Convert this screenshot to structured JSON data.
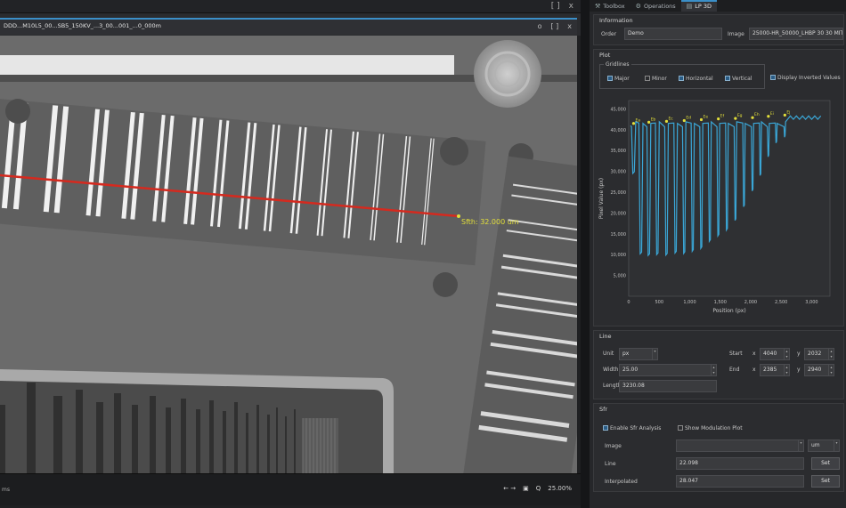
{
  "viewer": {
    "document_title": "DDD...M10L5_00...SB5_150KV_...3_00...001_...0_000m",
    "tab_buttons": [
      "o",
      "[ ]",
      "x"
    ],
    "top_buttons": [
      "[ ]",
      "x"
    ],
    "measurement_label": "Sfth: 32.000 um",
    "status_left": "ms",
    "status_right": {
      "nav": "← →",
      "zoom_icon_label": "Q",
      "zoom": "25.00%"
    }
  },
  "panel": {
    "tabs": [
      {
        "label": "Toolbox",
        "icon": "wrench-icon"
      },
      {
        "label": "Operations",
        "icon": "gear-icon"
      },
      {
        "label": "LP 3D",
        "icon": "document-icon"
      }
    ],
    "information": {
      "title": "Information",
      "order_label": "Order",
      "order_value": "Demo",
      "image_label": "Image",
      "image_value": "25000-HR_50000_LHBP 30 30 MIT"
    },
    "plot": {
      "title": "Plot",
      "gridlines_title": "Gridlines",
      "gridlines": [
        {
          "label": "Major",
          "checked": true
        },
        {
          "label": "Minor",
          "checked": false
        },
        {
          "label": "Horizontal",
          "checked": true
        },
        {
          "label": "Vertical",
          "checked": true
        }
      ],
      "display_inverted_label": "Display Inverted Values",
      "display_inverted_checked": true
    },
    "line": {
      "title": "Line",
      "unit_label": "Unit",
      "unit_value": "px",
      "width_label": "Width",
      "width_value": "25.00",
      "length_label": "Length",
      "length_value": "3230.08",
      "start_label": "Start",
      "start_x": "4040",
      "start_y": "2032",
      "end_label": "End",
      "end_x": "2385",
      "end_y": "2940",
      "x_label": "x",
      "y_label": "y"
    },
    "sfr": {
      "title": "Sfr",
      "enable_label": "Enable Sfr Analysis",
      "enable_checked": true,
      "modulation_label": "Show Modulation Plot",
      "modulation_checked": false,
      "image_label": "Image",
      "image_unit": "um",
      "line_label": "Line",
      "line_value": "22.098",
      "interpolated_label": "Interpolated",
      "interpolated_value": "28.047",
      "set_label": "Set"
    }
  },
  "colors": {
    "accent": "#3b8fc8",
    "profile_line": "#3aa6d6",
    "marker": "#e3df3a",
    "measure_line": "#d42a1f"
  },
  "chart_data": {
    "type": "line",
    "xlabel": "Position (px)",
    "ylabel": "Pixel Value (px)",
    "xlim": [
      0,
      3300
    ],
    "ylim": [
      0,
      47000
    ],
    "x_ticks": [
      0,
      500,
      1000,
      1500,
      2000,
      2500,
      3000
    ],
    "x_tick_labels": [
      "0",
      "500",
      "1,000",
      "1,500",
      "2,000",
      "2,500",
      "3,000"
    ],
    "y_ticks": [
      5000,
      10000,
      15000,
      20000,
      25000,
      30000,
      35000,
      40000,
      45000
    ],
    "y_tick_labels": [
      "5,000",
      "10,000",
      "15,000",
      "20,000",
      "25,000",
      "30,000",
      "35,000",
      "40,000",
      "45,000"
    ],
    "grid": true,
    "baseline": 41000,
    "dips": [
      {
        "x": 80,
        "min": 29500
      },
      {
        "x": 200,
        "min": 10200
      },
      {
        "x": 330,
        "min": 9800
      },
      {
        "x": 470,
        "min": 10000
      },
      {
        "x": 620,
        "min": 9900
      },
      {
        "x": 770,
        "min": 10400
      },
      {
        "x": 910,
        "min": 10300
      },
      {
        "x": 1050,
        "min": 10800
      },
      {
        "x": 1190,
        "min": 11500
      },
      {
        "x": 1330,
        "min": 13200
      },
      {
        "x": 1470,
        "min": 14500
      },
      {
        "x": 1610,
        "min": 15900
      },
      {
        "x": 1750,
        "min": 18200
      },
      {
        "x": 1890,
        "min": 21500
      },
      {
        "x": 2030,
        "min": 25300
      },
      {
        "x": 2160,
        "min": 29000
      },
      {
        "x": 2290,
        "min": 33500
      },
      {
        "x": 2420,
        "min": 36800
      },
      {
        "x": 2560,
        "min": 38200
      }
    ],
    "markers": [
      {
        "x": 80,
        "y": 41500,
        "label": "Ea"
      },
      {
        "x": 330,
        "y": 41800,
        "label": "Eb"
      },
      {
        "x": 620,
        "y": 42000,
        "label": "Ec"
      },
      {
        "x": 910,
        "y": 42200,
        "label": "Ed"
      },
      {
        "x": 1190,
        "y": 42400,
        "label": "Ee"
      },
      {
        "x": 1470,
        "y": 42600,
        "label": "Ef"
      },
      {
        "x": 1750,
        "y": 42700,
        "label": "Eg"
      },
      {
        "x": 2030,
        "y": 42900,
        "label": "Eh"
      },
      {
        "x": 2290,
        "y": 43200,
        "label": "Ei"
      },
      {
        "x": 2560,
        "y": 43500,
        "label": "Ej"
      }
    ]
  }
}
